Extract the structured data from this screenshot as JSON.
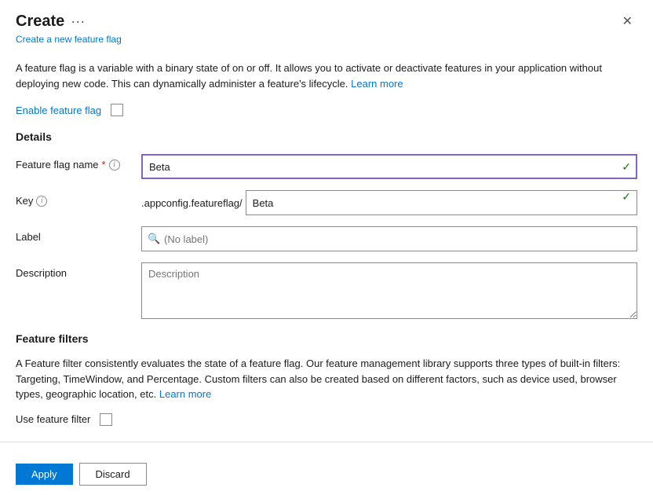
{
  "dialog": {
    "title": "Create",
    "subtitle": "Create a new feature flag",
    "close_label": "✕",
    "more_icon": "···"
  },
  "intro": {
    "text_part1": "A feature flag is a variable with a binary state of on or off. It allows you to activate or deactivate features in your application without deploying new code. This can dynamically administer a feature's lifecycle.",
    "learn_more": "Learn more"
  },
  "enable_section": {
    "label": "Enable feature flag"
  },
  "details": {
    "section_title": "Details",
    "feature_flag_name": {
      "label": "Feature flag name",
      "required": "*",
      "info": "i",
      "value": "Beta",
      "check": "✓"
    },
    "key": {
      "label": "Key",
      "info": "i",
      "prefix": ".appconfig.featureflag/",
      "value": "Beta",
      "check": "✓"
    },
    "label_field": {
      "label": "Label",
      "placeholder": "(No label)"
    },
    "description": {
      "label": "Description",
      "placeholder": "Description"
    }
  },
  "feature_filters": {
    "section_title": "Feature filters",
    "description_part1": "A Feature filter consistently evaluates the state of a feature flag. Our feature management library supports three types of built-in filters: Targeting, TimeWindow, and Percentage. Custom filters can also be created based on different factors, such as device used, browser types, geographic location, etc.",
    "learn_more": "Learn more",
    "use_filter_label": "Use feature filter"
  },
  "footer": {
    "apply_label": "Apply",
    "discard_label": "Discard"
  }
}
